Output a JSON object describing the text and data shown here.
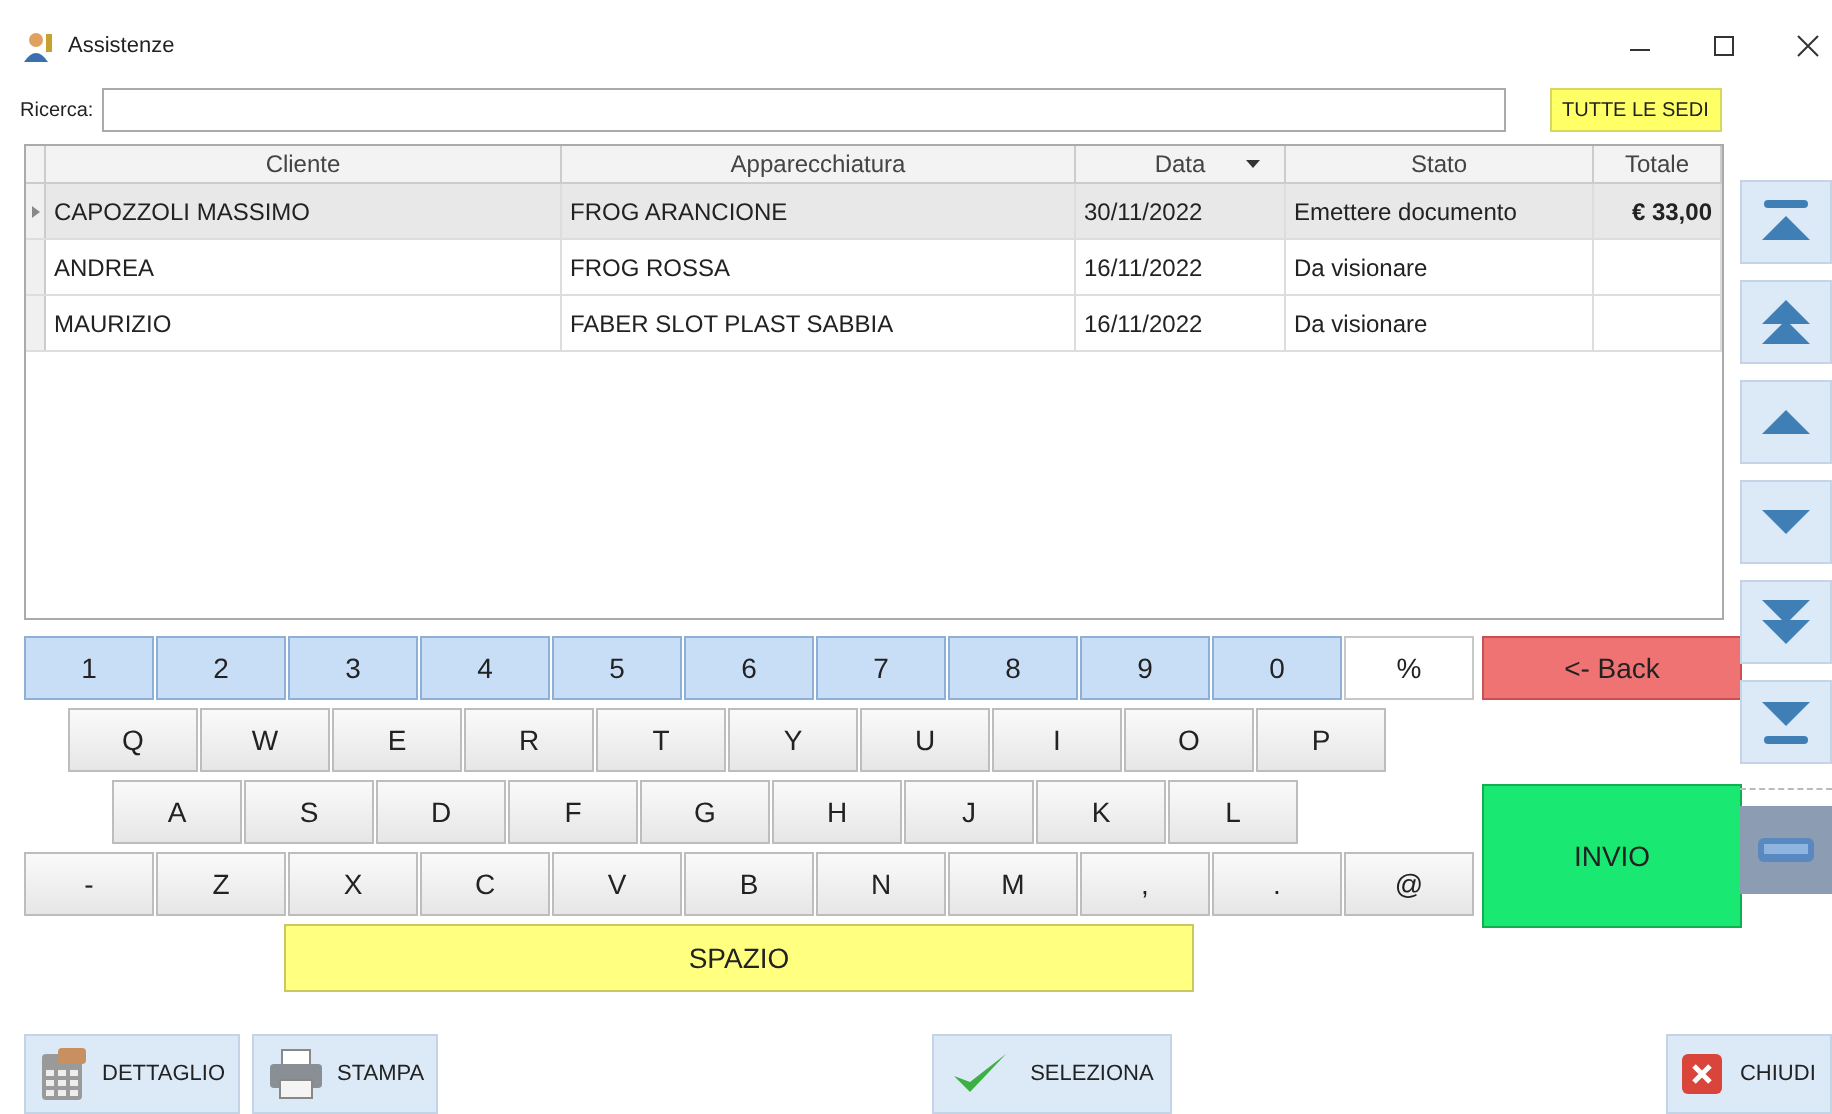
{
  "window": {
    "title": "Assistenze"
  },
  "search": {
    "label": "Ricerca:"
  },
  "filter_button": "TUTTE LE SEDI",
  "table": {
    "columns": [
      {
        "label": "Cliente",
        "sorted": false
      },
      {
        "label": "Apparecchiatura",
        "sorted": false
      },
      {
        "label": "Data",
        "sorted": true
      },
      {
        "label": "Stato",
        "sorted": false
      },
      {
        "label": "Totale",
        "sorted": false
      }
    ],
    "rows": [
      {
        "selected": true,
        "cells": [
          "CAPOZZOLI MASSIMO",
          "FROG ARANCIONE",
          "30/11/2022",
          "Emettere documento",
          "€ 33,00"
        ]
      },
      {
        "selected": false,
        "cells": [
          "ANDREA",
          "FROG ROSSA",
          "16/11/2022",
          "Da visionare",
          ""
        ]
      },
      {
        "selected": false,
        "cells": [
          "MAURIZIO",
          "FABER SLOT PLAST SABBIA",
          "16/11/2022",
          "Da visionare",
          ""
        ]
      }
    ]
  },
  "keyboard": {
    "rows": [
      [
        {
          "label": "1",
          "kind": "digit"
        },
        {
          "label": "2",
          "kind": "digit"
        },
        {
          "label": "3",
          "kind": "digit"
        },
        {
          "label": "4",
          "kind": "digit"
        },
        {
          "label": "5",
          "kind": "digit"
        },
        {
          "label": "6",
          "kind": "digit"
        },
        {
          "label": "7",
          "kind": "digit"
        },
        {
          "label": "8",
          "kind": "digit"
        },
        {
          "label": "9",
          "kind": "digit"
        },
        {
          "label": "0",
          "kind": "digit"
        },
        {
          "label": "%",
          "kind": "symbol"
        }
      ],
      [
        {
          "label": "Q",
          "kind": "letter"
        },
        {
          "label": "W",
          "kind": "letter"
        },
        {
          "label": "E",
          "kind": "letter"
        },
        {
          "label": "R",
          "kind": "letter"
        },
        {
          "label": "T",
          "kind": "letter"
        },
        {
          "label": "Y",
          "kind": "letter"
        },
        {
          "label": "U",
          "kind": "letter"
        },
        {
          "label": "I",
          "kind": "letter"
        },
        {
          "label": "O",
          "kind": "letter"
        },
        {
          "label": "P",
          "kind": "letter"
        }
      ],
      [
        {
          "label": "A",
          "kind": "letter"
        },
        {
          "label": "S",
          "kind": "letter"
        },
        {
          "label": "D",
          "kind": "letter"
        },
        {
          "label": "F",
          "kind": "letter"
        },
        {
          "label": "G",
          "kind": "letter"
        },
        {
          "label": "H",
          "kind": "letter"
        },
        {
          "label": "J",
          "kind": "letter"
        },
        {
          "label": "K",
          "kind": "letter"
        },
        {
          "label": "L",
          "kind": "letter"
        }
      ],
      [
        {
          "label": "-",
          "kind": "letter"
        },
        {
          "label": "Z",
          "kind": "letter"
        },
        {
          "label": "X",
          "kind": "letter"
        },
        {
          "label": "C",
          "kind": "letter"
        },
        {
          "label": "V",
          "kind": "letter"
        },
        {
          "label": "B",
          "kind": "letter"
        },
        {
          "label": "N",
          "kind": "letter"
        },
        {
          "label": "M",
          "kind": "letter"
        },
        {
          "label": ",",
          "kind": "letter"
        },
        {
          "label": ".",
          "kind": "letter"
        },
        {
          "label": "@",
          "kind": "letter"
        }
      ]
    ],
    "back": "<- Back",
    "enter": "INVIO",
    "space": "SPAZIO"
  },
  "buttons": [
    {
      "label": "DETTAGLIO",
      "kind": "detail"
    },
    {
      "label": "STAMPA",
      "kind": "print"
    },
    {
      "label": "SELEZIONA",
      "kind": "select"
    },
    {
      "label": "CHIUDI",
      "kind": "close"
    }
  ]
}
